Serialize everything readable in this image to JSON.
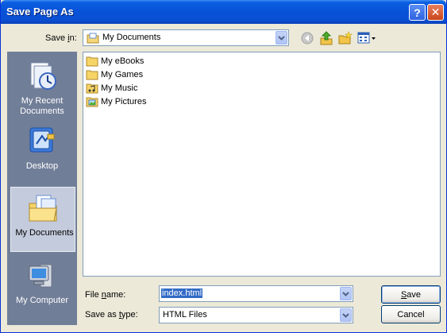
{
  "window": {
    "title": "Save Page As"
  },
  "titlebar": {
    "help_label": "?",
    "close_label": "✕"
  },
  "save_in": {
    "label_prefix": "Save ",
    "label_mnemonic": "i",
    "label_suffix": "n:",
    "value": "My Documents"
  },
  "toolbar": {
    "back_icon": "back-arrow-icon",
    "up_icon": "up-folder-icon",
    "new_folder_icon": "new-folder-icon",
    "view_icon": "view-menu-icon"
  },
  "places": [
    {
      "label_line1": "My Recent",
      "label_line2": "Documents",
      "icon": "recent-documents-icon"
    },
    {
      "label_line1": "Desktop",
      "label_line2": "",
      "icon": "desktop-icon"
    },
    {
      "label_line1": "My Documents",
      "label_line2": "",
      "icon": "my-documents-icon",
      "selected": true
    },
    {
      "label_line1": "My Computer",
      "label_line2": "",
      "icon": "my-computer-icon"
    }
  ],
  "files": [
    {
      "label": "My eBooks",
      "icon": "folder-icon"
    },
    {
      "label": "My Games",
      "icon": "folder-icon"
    },
    {
      "label": "My Music",
      "icon": "music-folder-icon"
    },
    {
      "label": "My Pictures",
      "icon": "pictures-folder-icon"
    }
  ],
  "file_name": {
    "label_prefix": "File ",
    "label_mnemonic": "n",
    "label_suffix": "ame:",
    "value": "index.html"
  },
  "save_as_type": {
    "label_prefix": "Save as ",
    "label_mnemonic": "t",
    "label_suffix": "ype:",
    "value": "HTML Files"
  },
  "buttons": {
    "save_mnemonic": "S",
    "save_rest": "ave",
    "cancel": "Cancel"
  },
  "colors": {
    "title_blue": "#0852d8",
    "places_bar": "#717e98",
    "selection": "#316ac5",
    "close_red": "#c9451a"
  }
}
